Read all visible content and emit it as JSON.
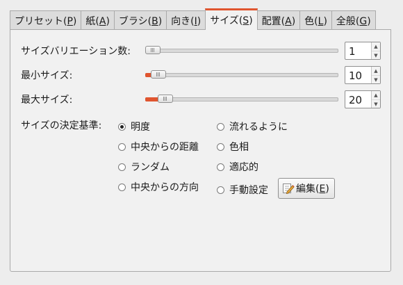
{
  "tabs": [
    {
      "text": "プリセット(",
      "mn": "P",
      "close": ")",
      "active": false
    },
    {
      "text": "紙(",
      "mn": "A",
      "close": ")",
      "active": false
    },
    {
      "text": "ブラシ(",
      "mn": "B",
      "close": ")",
      "active": false
    },
    {
      "text": "向き(",
      "mn": "I",
      "close": ")",
      "active": false
    },
    {
      "text": "サイズ(",
      "mn": "S",
      "close": ")",
      "active": true
    },
    {
      "text": "配置(",
      "mn": "A",
      "close": ")",
      "active": false
    },
    {
      "text": "色(",
      "mn": "L",
      "close": ")",
      "active": false
    },
    {
      "text": "全般(",
      "mn": "G",
      "close": ")",
      "active": false
    }
  ],
  "size_variation": {
    "label": "サイズバリエーション数:",
    "value": "1",
    "level": 0
  },
  "min_size": {
    "label": "最小サイズ:",
    "value": "10",
    "level": 0.03
  },
  "max_size": {
    "label": "最大サイズ:",
    "value": "20",
    "level": 0.07
  },
  "basis_label": "サイズの決定基準:",
  "options": {
    "brightness": "明度",
    "distance": "中央からの距離",
    "random": "ランダム",
    "direction": "中央からの方向",
    "flow": "流れるように",
    "hue": "色相",
    "adaptive": "適応的",
    "manual": "手動設定"
  },
  "selected_option": "brightness",
  "edit_button": {
    "text": "編集(",
    "mn": "E",
    "close": ")"
  },
  "spin_arrows": {
    "up": "▲",
    "down": "▼"
  },
  "colors": {
    "accent": "#e0552f"
  }
}
